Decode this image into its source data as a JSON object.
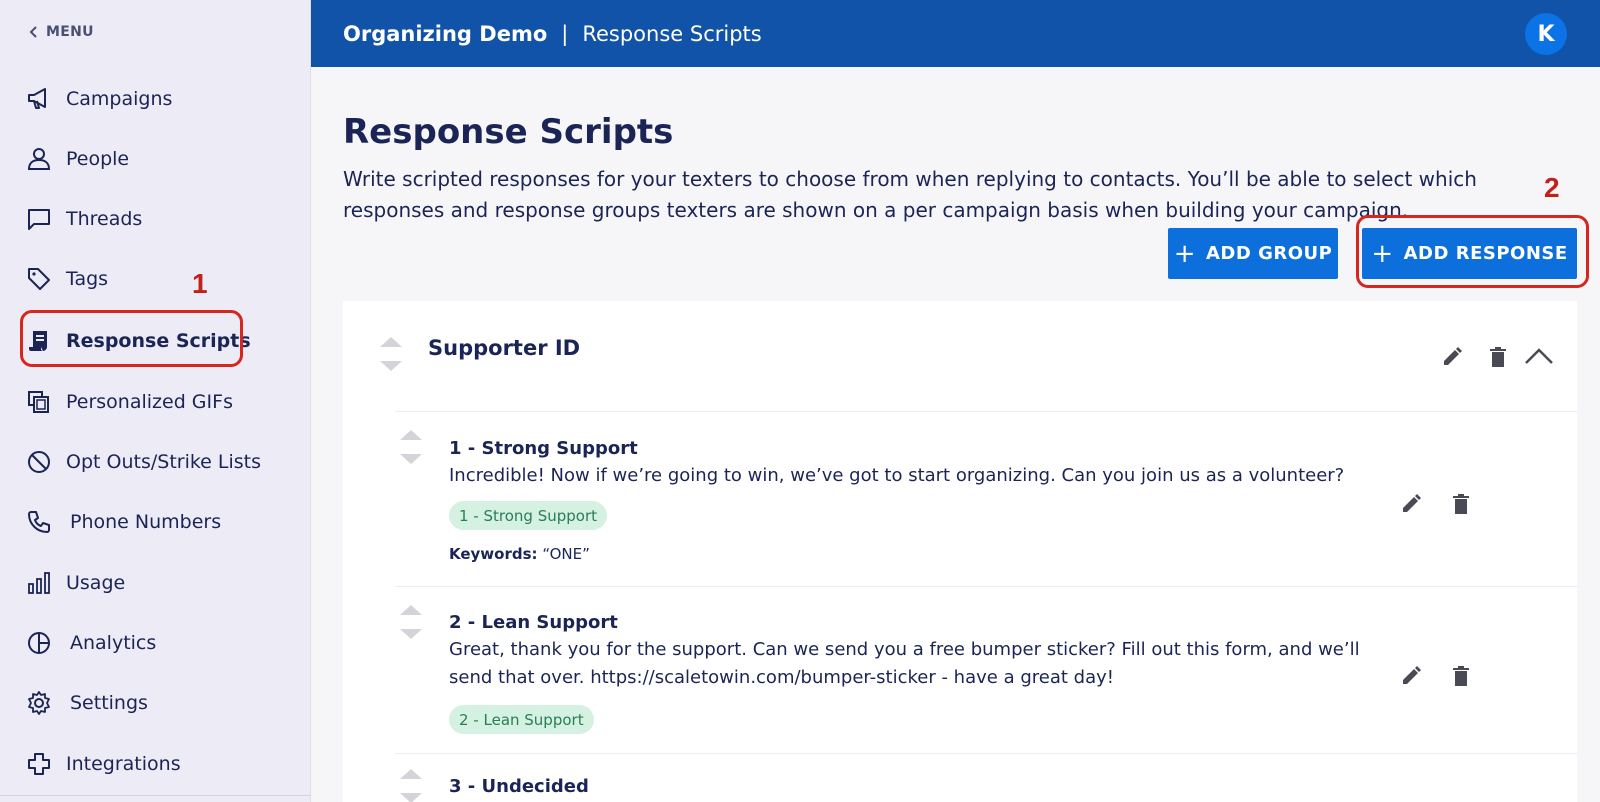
{
  "sidebar": {
    "menu_label": "MENU",
    "items": [
      {
        "label": "Campaigns",
        "icon": "megaphone-icon"
      },
      {
        "label": "People",
        "icon": "person-icon"
      },
      {
        "label": "Threads",
        "icon": "chat-icon"
      },
      {
        "label": "Tags",
        "icon": "tag-icon"
      },
      {
        "label": "Response Scripts",
        "icon": "script-icon",
        "active": true
      },
      {
        "label": "Personalized GIFs",
        "icon": "copy-icon"
      },
      {
        "label": "Opt Outs/Strike Lists",
        "icon": "block-icon"
      },
      {
        "label": "Phone Numbers",
        "icon": "phone-icon"
      },
      {
        "label": "Usage",
        "icon": "bar-chart-icon"
      },
      {
        "label": "Analytics",
        "icon": "pie-chart-icon"
      },
      {
        "label": "Settings",
        "icon": "gear-icon"
      },
      {
        "label": "Integrations",
        "icon": "puzzle-icon"
      }
    ]
  },
  "header": {
    "org_name": "Organizing Demo",
    "separator": "|",
    "page_name": "Response Scripts",
    "avatar_initial": "K"
  },
  "main": {
    "title": "Response Scripts",
    "description": "Write scripted responses for your texters to choose from when replying to contacts. You’ll be able to select which responses and response groups texters are shown on a per campaign basis when building your campaign.",
    "add_group_label": "ADD GROUP",
    "add_response_label": "ADD RESPONSE",
    "group": {
      "name": "Supporter ID",
      "responses": [
        {
          "title": "1 - Strong Support",
          "text": "Incredible! Now if we’re going to win, we’ve got to start organizing. Can you join us as a volunteer?",
          "tag": "1 - Strong Support",
          "keywords_label": "Keywords:",
          "keywords": "“ONE”"
        },
        {
          "title": "2 - Lean Support",
          "text": "Great, thank you for the support. Can we send you a free bumper sticker? Fill out this form, and we’ll send that over. https://scaletowin.com/bumper-sticker - have a great day!",
          "tag": "2 - Lean Support"
        },
        {
          "title": "3 - Undecided"
        }
      ]
    }
  },
  "annotations": {
    "step1": "1",
    "step2": "2"
  },
  "colors": {
    "header_bg": "#1053a8",
    "button_bg": "#0d6fdc",
    "annotation_red": "#d6261d",
    "tag_bg": "#d4f1e2"
  }
}
